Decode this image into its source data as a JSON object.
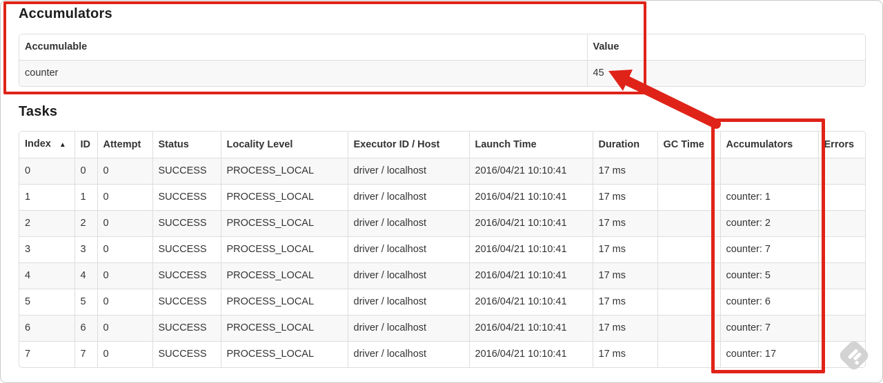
{
  "ui_colors": {
    "annotation_red": "#e02318",
    "table_border": "#dddddd",
    "stripe_background": "#f8f8f8",
    "text": "#333333",
    "heading_text": "#1c1c1c"
  },
  "accumulators_section": {
    "title": "Accumulators",
    "table": {
      "columns": [
        {
          "label": "Accumulable"
        },
        {
          "label": "Value"
        }
      ],
      "rows": [
        [
          "counter",
          "45"
        ]
      ]
    }
  },
  "tasks_section": {
    "title": "Tasks",
    "table": {
      "columns": [
        {
          "label": "Index",
          "sort_icon": "▲"
        },
        {
          "label": "ID"
        },
        {
          "label": "Attempt"
        },
        {
          "label": "Status"
        },
        {
          "label": "Locality Level"
        },
        {
          "label": "Executor ID / Host"
        },
        {
          "label": "Launch Time"
        },
        {
          "label": "Duration"
        },
        {
          "label": "GC Time"
        },
        {
          "label": "Accumulators"
        },
        {
          "label": "Errors"
        }
      ],
      "rows": [
        [
          "0",
          "0",
          "0",
          "SUCCESS",
          "PROCESS_LOCAL",
          "driver / localhost",
          "2016/04/21 10:10:41",
          "17 ms",
          "",
          "",
          ""
        ],
        [
          "1",
          "1",
          "0",
          "SUCCESS",
          "PROCESS_LOCAL",
          "driver / localhost",
          "2016/04/21 10:10:41",
          "17 ms",
          "",
          "counter: 1",
          ""
        ],
        [
          "2",
          "2",
          "0",
          "SUCCESS",
          "PROCESS_LOCAL",
          "driver / localhost",
          "2016/04/21 10:10:41",
          "17 ms",
          "",
          "counter: 2",
          ""
        ],
        [
          "3",
          "3",
          "0",
          "SUCCESS",
          "PROCESS_LOCAL",
          "driver / localhost",
          "2016/04/21 10:10:41",
          "17 ms",
          "",
          "counter: 7",
          ""
        ],
        [
          "4",
          "4",
          "0",
          "SUCCESS",
          "PROCESS_LOCAL",
          "driver / localhost",
          "2016/04/21 10:10:41",
          "17 ms",
          "",
          "counter: 5",
          ""
        ],
        [
          "5",
          "5",
          "0",
          "SUCCESS",
          "PROCESS_LOCAL",
          "driver / localhost",
          "2016/04/21 10:10:41",
          "17 ms",
          "",
          "counter: 6",
          ""
        ],
        [
          "6",
          "6",
          "0",
          "SUCCESS",
          "PROCESS_LOCAL",
          "driver / localhost",
          "2016/04/21 10:10:41",
          "17 ms",
          "",
          "counter: 7",
          ""
        ],
        [
          "7",
          "7",
          "0",
          "SUCCESS",
          "PROCESS_LOCAL",
          "driver / localhost",
          "2016/04/21 10:10:41",
          "17 ms",
          "",
          "counter: 17",
          ""
        ]
      ]
    }
  }
}
